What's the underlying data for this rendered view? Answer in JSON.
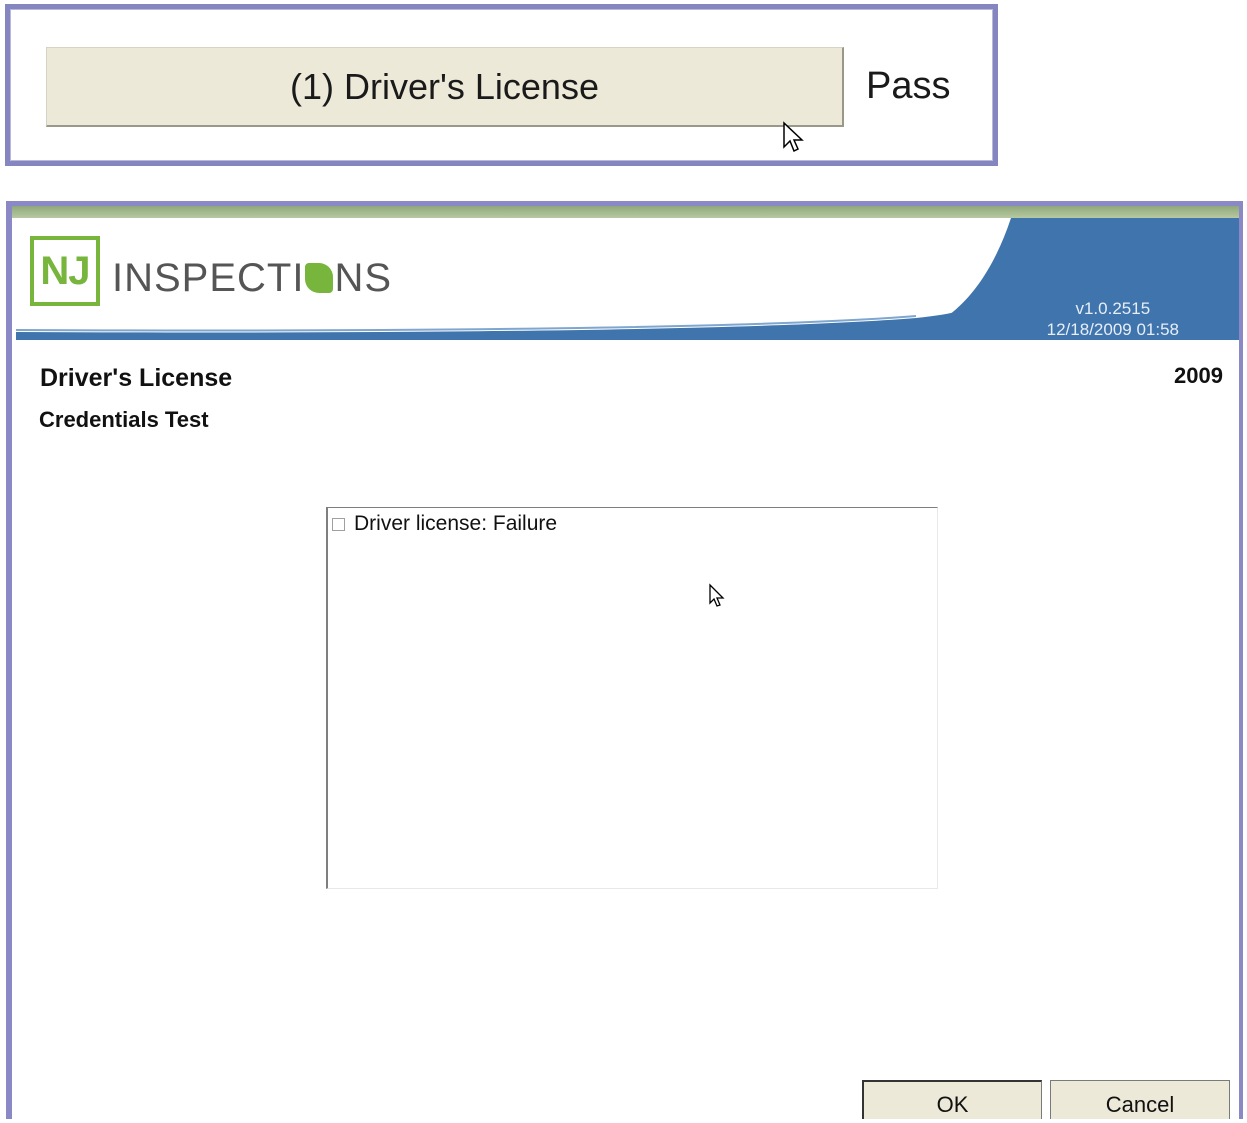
{
  "task_row": {
    "button_label": "(1) Driver's License",
    "status": "Pass"
  },
  "header": {
    "logo_badge": "NJ",
    "logo_word_before": "INSPECTI",
    "logo_word_after": "NS",
    "version": "v1.0.2515",
    "datetime": "12/18/2009 01:58"
  },
  "form": {
    "title": "Driver's License",
    "subtitle": "Credentials Test",
    "year": "2009"
  },
  "checklist": {
    "items": [
      {
        "label": "Driver license: Failure",
        "checked": false
      }
    ]
  },
  "buttons": {
    "ok": "OK",
    "cancel": "Cancel"
  },
  "colors": {
    "frame": "#8a89c6",
    "brand_green": "#77b53c",
    "banner_blue": "#3f74ac",
    "button_face": "#ece9d8"
  }
}
